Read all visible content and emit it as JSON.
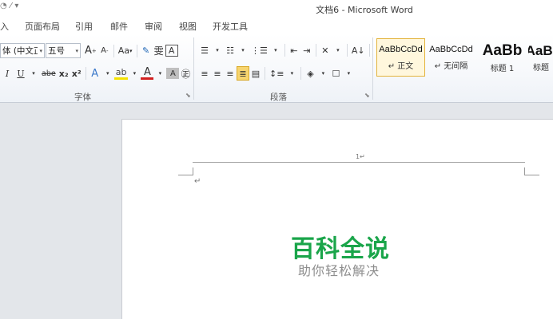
{
  "window": {
    "title": "文档6 - Microsoft Word"
  },
  "tabs": [
    "入",
    "页面布局",
    "引用",
    "邮件",
    "审阅",
    "视图",
    "开发工具"
  ],
  "font_group": {
    "font_name": "体 (中文正文",
    "font_size": "五号",
    "label": "字体",
    "row1": {
      "grow": "A",
      "shrink": "A",
      "change_case": "Aa",
      "phonetic": "雯",
      "char_border": "A"
    },
    "row2": {
      "italic": "I",
      "underline": "U",
      "strike": "abe",
      "subscript": "x₂",
      "superscript": "x²",
      "text_effect": "A",
      "font_color": "A",
      "char_shading": "A",
      "enclose": "㊣"
    }
  },
  "paragraph_group": {
    "label": "段落"
  },
  "styles": [
    {
      "sample": "AaBbCcDd",
      "name": "↵ 正文",
      "selected": true
    },
    {
      "sample": "AaBbCcDd",
      "name": "↵ 无间隔",
      "selected": false
    },
    {
      "sample": "AaBb",
      "name": "标题 1",
      "selected": false
    },
    {
      "sample": "AaBl",
      "name": "标题",
      "selected": false
    }
  ],
  "document": {
    "header_mark": "1↵",
    "paragraph_mark": "↵"
  },
  "watermark": {
    "title": "百科全说",
    "subtitle": "助你轻松解决"
  },
  "colors": {
    "highlight": "#f5e200",
    "font_color": "#d21f1f",
    "watermark_green": "#1aa54a"
  }
}
